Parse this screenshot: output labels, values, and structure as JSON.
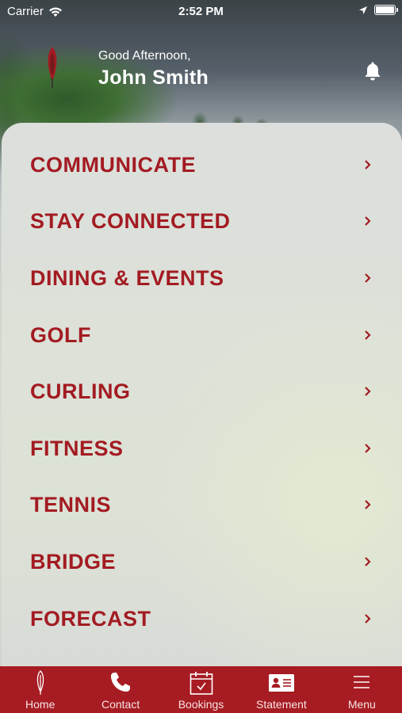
{
  "status_bar": {
    "carrier": "Carrier",
    "time": "2:52 PM"
  },
  "header": {
    "greeting": "Good Afternoon,",
    "username": "John Smith"
  },
  "menu": {
    "items": [
      {
        "label": "COMMUNICATE"
      },
      {
        "label": "STAY CONNECTED"
      },
      {
        "label": "DINING & EVENTS"
      },
      {
        "label": "GOLF"
      },
      {
        "label": "CURLING"
      },
      {
        "label": "FITNESS"
      },
      {
        "label": "TENNIS"
      },
      {
        "label": "BRIDGE"
      },
      {
        "label": "FORECAST"
      }
    ]
  },
  "tabbar": {
    "tabs": [
      {
        "label": "Home",
        "icon": "feather-icon"
      },
      {
        "label": "Contact",
        "icon": "phone-icon"
      },
      {
        "label": "Bookings",
        "icon": "calendar-icon"
      },
      {
        "label": "Statement",
        "icon": "statement-card-icon"
      },
      {
        "label": "Menu",
        "icon": "hamburger-icon"
      }
    ]
  },
  "colors": {
    "accent": "#a31b22",
    "tabbar_bg": "#a61c22"
  }
}
